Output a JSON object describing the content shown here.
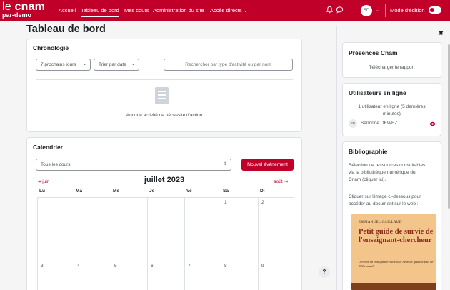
{
  "navbar": {
    "logo_main": "le ",
    "logo_bold": "cnam",
    "logo_sub": "par-demo",
    "items": [
      {
        "label": "Accueil"
      },
      {
        "label": "Tableau de bord"
      },
      {
        "label": "Mes cours"
      },
      {
        "label": "Administration du site"
      },
      {
        "label": "Accès directs"
      }
    ],
    "avatar_initials": "SD",
    "edit_mode_label": "Mode d'édition",
    "accent": "#c1002a"
  },
  "page": {
    "title": "Tableau de bord"
  },
  "timeline": {
    "title": "Chronologie",
    "filter_days": "7 prochains jours",
    "sort": "Trier par date",
    "search_placeholder": "Rechercher par type d'activité ou par nom",
    "empty_text": "Aucune activité ne nécessite d'action"
  },
  "calendar": {
    "title": "Calendrier",
    "course_filter": "Tous les cours",
    "new_event": "Nouvel événement",
    "prev_month": "juin",
    "next_month": "août",
    "month_title": "juillet 2023",
    "weekdays": [
      "Lu",
      "Ma",
      "Me",
      "Je",
      "Ve",
      "Sa",
      "Di"
    ],
    "week1": [
      "",
      "",
      "",
      "",
      "",
      "1",
      "2"
    ],
    "week2": [
      "3",
      "4",
      "5",
      "6",
      "7",
      "8",
      "9"
    ]
  },
  "drawer": {
    "presences": {
      "title": "Présences Cnam",
      "link": "Télécharger le rapport"
    },
    "online": {
      "title": "Utilisateurs en ligne",
      "summary_line1": "1 utilisateur en ligne (5 dernières",
      "summary_line2": "minutes)",
      "user_initials": "SD",
      "user_name": "Sandrine DEWEZ"
    },
    "bibliography": {
      "title": "Bibliographie",
      "text_line1": "Sélection de ressources consultables",
      "text_line2": "via la bibliothèque numérique du",
      "text_line3": "Cnam (cliquer ici).",
      "hint_line1": "Cliquer sur l'image ci-dessous pour",
      "hint_line2": "accéder au document sur le web :",
      "book": {
        "author": "EMMANUEL CAILLAUD",
        "title": "Petit guide de survie de l'enseignant-chercheur",
        "subtitle": "Devenir un enseignant-chercheur heureux grâce à plus de 200 conseils"
      }
    }
  },
  "help": {
    "label": "?"
  }
}
